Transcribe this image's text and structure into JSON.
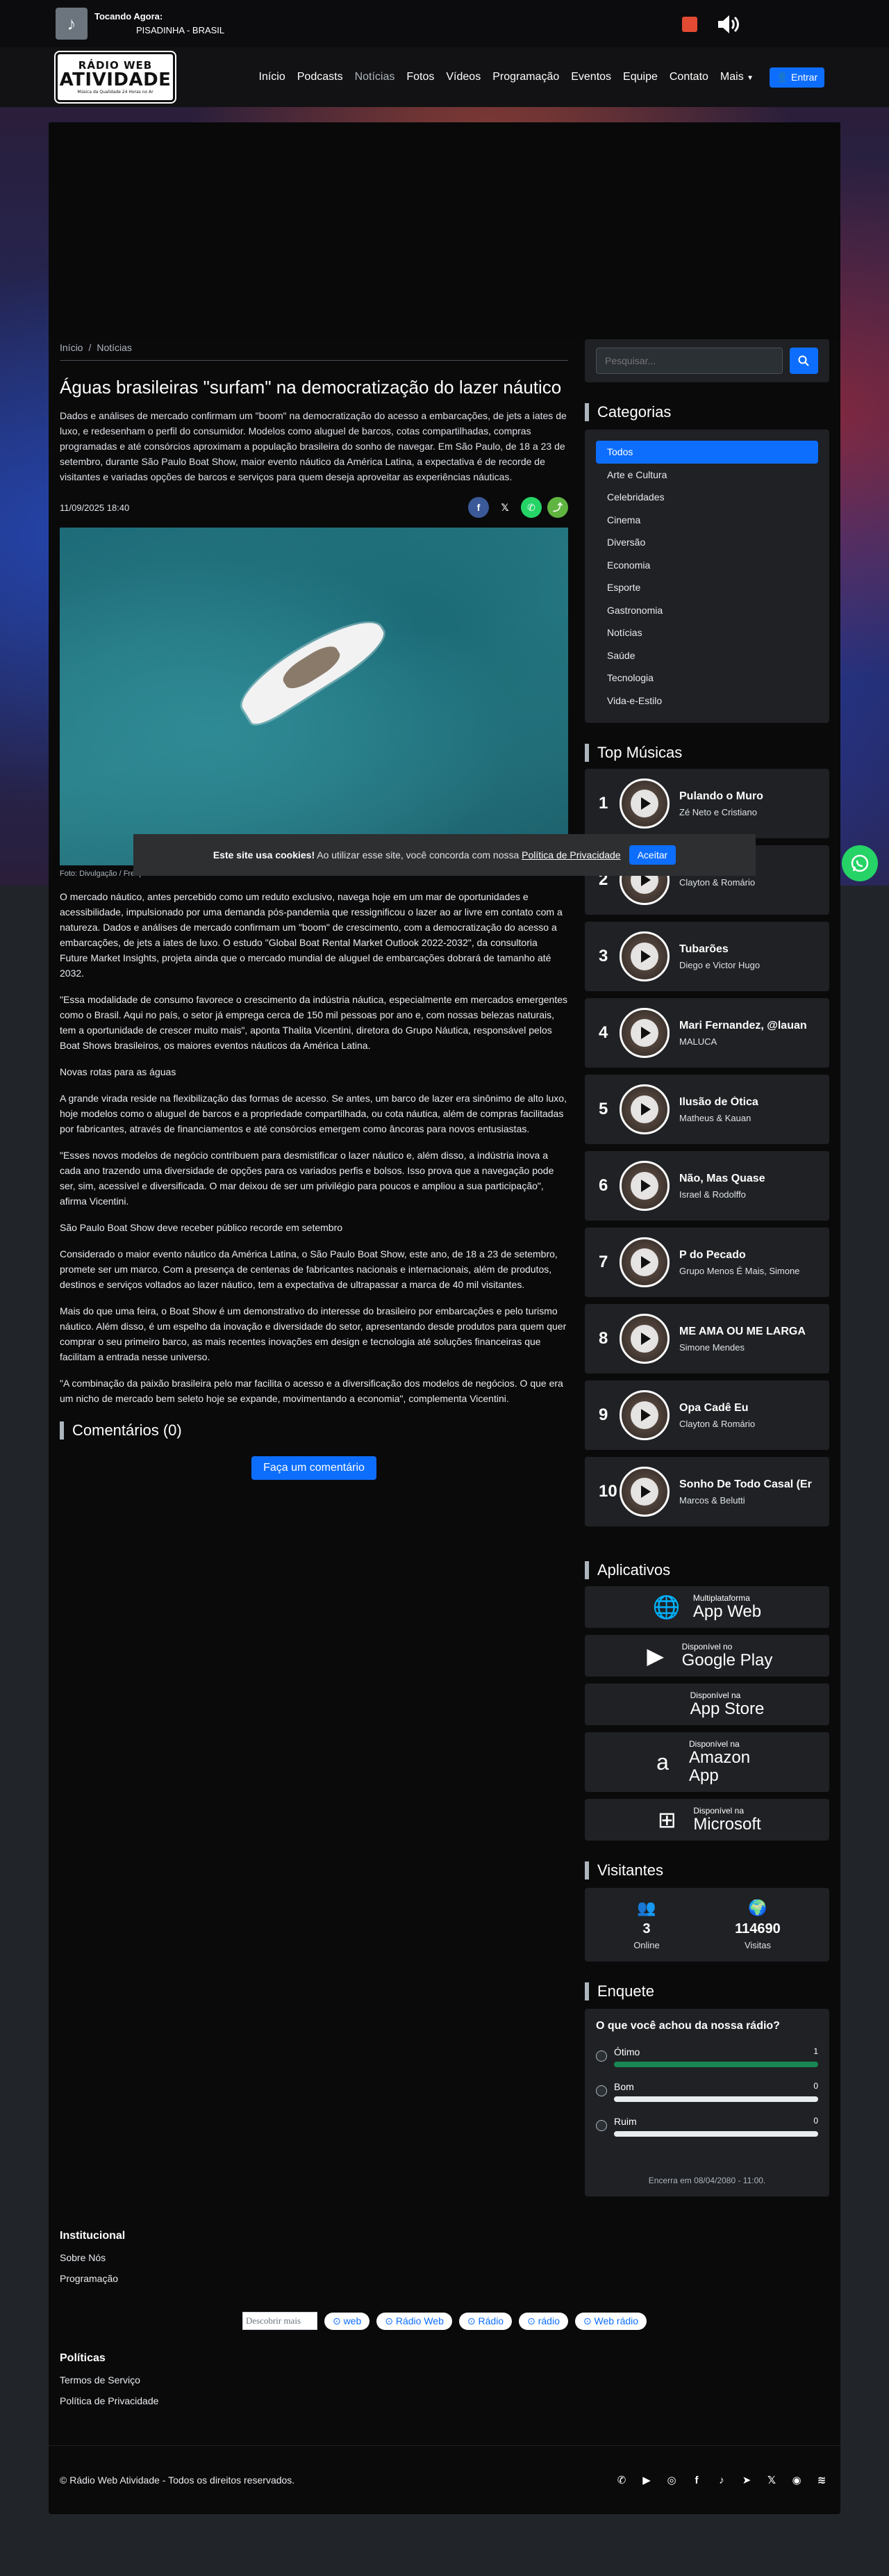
{
  "player": {
    "now_playing_label": "Tocando Agora:",
    "now_playing_title": "PISADINHA - BRASIL"
  },
  "nav": {
    "logo_line1": "RÁDIO WEB",
    "logo_line2": "ATIVIDADE",
    "logo_line3": "Música da Qualidade 24 Horas no Ar",
    "links": [
      "Início",
      "Podcasts",
      "Notícias",
      "Fotos",
      "Vídeos",
      "Programação",
      "Eventos",
      "Equipe",
      "Contato",
      "Mais"
    ],
    "login_label": "Entrar"
  },
  "breadcrumb": {
    "home": "Início",
    "current": "Notícias"
  },
  "article": {
    "title": "Águas brasileiras \"surfam\" na democratização do lazer náutico",
    "lead": "Dados e análises de mercado confirmam um \"boom\" na democratização do acesso a embarcações, de jets a iates de luxo, e redesenham o perfil do consumidor. Modelos como aluguel de barcos, cotas compartilhadas, compras programadas e até consórcios aproximam a população brasileira do sonho de navegar. Em São Paulo, de 18 a 23 de setembro, durante São Paulo Boat Show, maior evento náutico da América Latina, a expectativa é de recorde de visitantes e variadas opções de barcos e serviços para quem deseja aproveitar as experiências náuticas.",
    "date": "11/09/2025 18:40",
    "photo_caption": "Foto: Divulgação / Freepik",
    "paragraphs": [
      "O mercado náutico, antes percebido como um reduto exclusivo, navega hoje em um mar de oportunidades e acessibilidade, impulsionado por uma demanda pós-pandemia que ressignificou o lazer ao ar livre em contato com a natureza. Dados e análises de mercado confirmam um \"boom\" de crescimento, com a democratização do acesso a embarcações, de jets a iates de luxo. O estudo \"Global Boat Rental Market Outlook 2022-2032\", da consultoria Future Market Insights, projeta ainda que o mercado mundial de aluguel de embarcações dobrará de tamanho até 2032.",
      "\"Essa modalidade de consumo favorece o crescimento da indústria náutica, especialmente em mercados emergentes como o Brasil. Aqui no país, o setor já emprega cerca de 150 mil pessoas por ano e, com nossas belezas naturais, tem a oportunidade de crescer muito mais\", aponta Thalita Vicentini, diretora do Grupo Náutica, responsável pelos Boat Shows brasileiros, os maiores eventos náuticos da América Latina.",
      "Novas rotas para as águas",
      "A grande virada reside na flexibilização das formas de acesso. Se antes, um barco de lazer era sinônimo de alto luxo, hoje modelos como o aluguel de barcos e a propriedade compartilhada, ou cota náutica, além de compras facilitadas por fabricantes, através de financiamentos e até consórcios emergem como âncoras para novos entusiastas.",
      "\"Esses novos modelos de negócio contribuem para desmistificar o lazer náutico e, além disso, a indústria inova a cada ano trazendo uma diversidade de opções para os variados perfis e bolsos. Isso prova que a navegação pode ser, sim, acessível e diversificada. O mar deixou de ser um privilégio para poucos e ampliou a sua participação\", afirma Vicentini.",
      "São Paulo Boat Show deve receber público recorde em setembro",
      "Considerado o maior evento náutico da América Latina, o São Paulo Boat Show, este ano, de 18 a 23 de setembro, promete ser um marco. Com a presença de centenas de fabricantes nacionais e internacionais, além de produtos, destinos e serviços voltados ao lazer náutico, tem a expectativa de ultrapassar a marca de 40 mil visitantes.",
      "Mais do que uma feira, o Boat Show é um demonstrativo do interesse do brasileiro por embarcações e pelo turismo náutico. Além disso, é um espelho da inovação e diversidade do setor, apresentando desde produtos para quem quer comprar o seu primeiro barco, as mais recentes inovações em design e tecnologia até soluções financeiras que facilitam a entrada nesse universo.",
      "\"A combinação da paixão brasileira pelo mar facilita o acesso e a diversificação dos modelos de negócios. O que era um nicho de mercado bem seleto hoje se expande, movimentando a economia\", complementa Vicentini."
    ]
  },
  "comments": {
    "title": "Comentários (0)",
    "button": "Faça um comentário"
  },
  "search": {
    "placeholder": "Pesquisar..."
  },
  "categories": {
    "title": "Categorias",
    "items": [
      "Todos",
      "Arte e Cultura",
      "Celebridades",
      "Cinema",
      "Diversão",
      "Economia",
      "Esporte",
      "Gastronomia",
      "Notícias",
      "Saúde",
      "Tecnologia",
      "Vida-e-Estilo"
    ]
  },
  "top_music": {
    "title": "Top Músicas",
    "items": [
      {
        "rank": "1",
        "song": "Pulando o Muro",
        "artist": "Zé Neto e Cristiano"
      },
      {
        "rank": "2",
        "song": "",
        "artist": "Clayton & Romário"
      },
      {
        "rank": "3",
        "song": "Tubarões",
        "artist": "Diego e Victor Hugo"
      },
      {
        "rank": "4",
        "song": "Mari Fernandez, @lauan",
        "artist": "MALUCA"
      },
      {
        "rank": "5",
        "song": "Ilusão de Ótica",
        "artist": "Matheus & Kauan"
      },
      {
        "rank": "6",
        "song": "Não, Mas Quase",
        "artist": "Israel & Rodolffo"
      },
      {
        "rank": "7",
        "song": "P do Pecado",
        "artist": "Grupo Menos É Mais, Simone"
      },
      {
        "rank": "8",
        "song": "ME AMA OU ME LARGA",
        "artist": "Simone Mendes"
      },
      {
        "rank": "9",
        "song": "Opa Cadê Eu",
        "artist": "Clayton & Romário"
      },
      {
        "rank": "10",
        "song": "Sonho De Todo Casal (Er",
        "artist": "Marcos & Belutti"
      }
    ]
  },
  "apps": {
    "title": "Aplicativos",
    "items": [
      {
        "small": "Multiplataforma",
        "big": "App Web",
        "icon": "globe-icon"
      },
      {
        "small": "Disponível no",
        "big": "Google Play",
        "icon": "play-store-icon"
      },
      {
        "small": "Disponível na",
        "big": "App Store",
        "icon": "apple-icon"
      },
      {
        "small": "Disponível na",
        "big": "Amazon App",
        "icon": "amazon-icon"
      },
      {
        "small": "Disponível na",
        "big": "Microsoft",
        "icon": "windows-icon"
      }
    ]
  },
  "visitors": {
    "title": "Visitantes",
    "online_value": "3",
    "online_label": "Online",
    "visits_value": "114690",
    "visits_label": "Visitas"
  },
  "poll": {
    "title": "Enquete",
    "question": "O que você achou da nossa rádio?",
    "options": [
      {
        "label": "Ótimo",
        "count": "1",
        "fill": 1.0
      },
      {
        "label": "Bom",
        "count": "0",
        "fill": 0
      },
      {
        "label": "Ruim",
        "count": "0",
        "fill": 0
      }
    ],
    "end_text": "Encerra em 08/04/2080 - 11:00."
  },
  "cookie": {
    "bold": "Este site usa cookies!",
    "text": "Ao utilizar esse site, você concorda com nossa",
    "link": "Política de Privacidade",
    "button": "Aceitar"
  },
  "footer": {
    "institutional_title": "Institucional",
    "institutional_links": [
      "Sobre Nós",
      "Programação"
    ],
    "tags_placeholder": "Descobrir mais",
    "tags": [
      "web",
      "Rádio Web",
      "Rádio",
      "rádio",
      "Web rádio"
    ],
    "policies_title": "Políticas",
    "policies_links": [
      "Termos de Serviço",
      "Política de Privacidade"
    ],
    "copyright": "© Rádio Web Atividade - Todos os direitos reservados."
  }
}
